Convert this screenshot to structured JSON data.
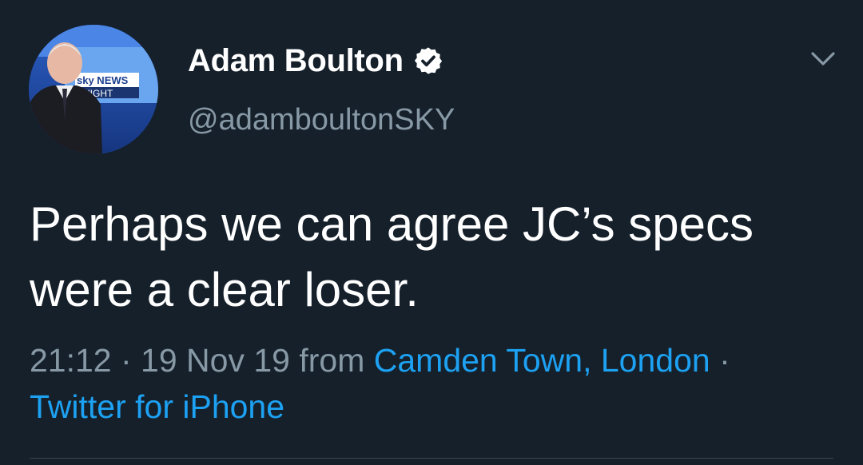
{
  "author": {
    "display_name": "Adam Boulton",
    "handle": "@adamboultonSKY",
    "verified": true,
    "avatar_label_line1": "sky NEWS",
    "avatar_label_line2": "NIGHT"
  },
  "tweet": {
    "text_line1": "Perhaps we can agree JC’s specs",
    "text_line2": "were a clear loser.",
    "time": "21:12",
    "separator": " · ",
    "date": "19 Nov 19",
    "from_label": " from ",
    "location": "Camden Town, London",
    "separator2": " ·",
    "source": "Twitter for iPhone"
  },
  "icons": {
    "verified": "verified-badge-icon",
    "menu": "chevron-down-icon"
  },
  "colors": {
    "background": "#15202b",
    "primary_text": "#ffffff",
    "secondary_text": "#8899a6",
    "link": "#1da1f2",
    "divider": "#38444d"
  }
}
